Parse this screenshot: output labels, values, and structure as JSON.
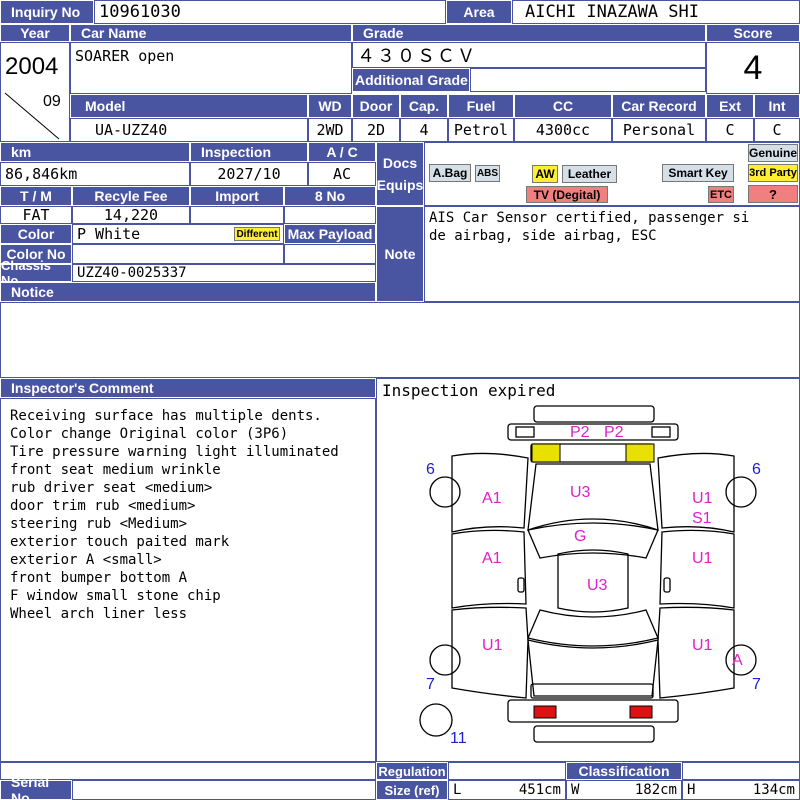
{
  "inquiry": {
    "label": "Inquiry No",
    "value": "10961030"
  },
  "area": {
    "label": "Area",
    "value": "AICHI INAZAWA SHI"
  },
  "headers": {
    "year": "Year",
    "car_name": "Car Name",
    "grade": "Grade",
    "score": "Score",
    "additional_grade": "Additional Grade",
    "model": "Model",
    "wd": "WD",
    "door": "Door",
    "cap": "Cap.",
    "fuel": "Fuel",
    "cc": "CC",
    "car_record": "Car Record",
    "ext": "Ext",
    "int": "Int",
    "km": "km",
    "inspection": "Inspection",
    "ac": "A / C",
    "tm": "T / M",
    "recycle_fee": "Recyle Fee",
    "import": "Import",
    "no8": "8 No",
    "color": "Color",
    "max_payload": "Max Payload",
    "color_no": "Color No",
    "chassis_no": "Chassis No",
    "notice": "Notice",
    "docs": "Docs",
    "equips": "Equips",
    "note": "Note",
    "inspector_comment": "Inspector's Comment",
    "regulation": "Regulation",
    "classification": "Classification",
    "size_ref": "Size (ref)",
    "serial_no": "Serial No"
  },
  "vehicle": {
    "year": "2004",
    "month": "09",
    "car_name": "SOARER open",
    "grade": "４３０ＳＣＶ",
    "score": "4",
    "model": "UA-UZZ40",
    "wd": "2WD",
    "door": "2D",
    "cap": "4",
    "fuel": "Petrol",
    "cc": "4300cc",
    "car_record": "Personal",
    "ext": "C",
    "int": "C",
    "km": "86,846km",
    "inspection": "2027/10",
    "ac": "AC",
    "tm": "FAT",
    "recycle_fee": "14,220",
    "color": "P White",
    "different_badge": "Different",
    "chassis_no": "UZZ40-0025337"
  },
  "equips": {
    "abag": "A.Bag",
    "abs": "ABS",
    "aw": "AW",
    "leather": "Leather",
    "tv": "TV (Degital)",
    "smart_key": "Smart Key",
    "etc": "ETC",
    "genuine": "Genuine",
    "third_party": "3rd Party",
    "question": "?"
  },
  "note_lines": [
    "AIS Car Sensor certified, passenger si",
    "de airbag, side airbag, ESC"
  ],
  "inspection_note": "Inspection expired",
  "comments": [
    "Receiving surface has multiple dents.",
    "Color change Original color (3P6)",
    "Tire pressure warning light illuminated",
    "front seat medium wrinkle",
    "rub driver seat <medium>",
    "door trim rub <medium>",
    "steering rub <Medium>",
    "exterior touch paited mark",
    "exterior A <small>",
    "front bumper bottom A",
    "F window small stone chip",
    "Wheel arch liner less"
  ],
  "diagram_marks": {
    "p2a": "P2",
    "p2b": "P2",
    "u3_front": "U3",
    "g": "G",
    "u3_roof": "U3",
    "a1_left_front": "A1",
    "a1_left_door": "A1",
    "u1_left_rear": "U1",
    "u1_right_front": "U1",
    "s1_right_front": "S1",
    "u1_right_door": "U1",
    "u1_right_rear": "U1",
    "a_wheel": "A",
    "n6_left": "6",
    "n6_right": "6",
    "n7_left": "7",
    "n7_right": "7",
    "n11": "11"
  },
  "size": {
    "l_label": "L",
    "l_value": "451cm",
    "w_label": "W",
    "w_value": "182cm",
    "h_label": "H",
    "h_value": "134cm"
  },
  "colors": {
    "header_blue": "#4a55a2",
    "pink_mark": "#e020c8",
    "blue_mark": "#1a22d0"
  }
}
